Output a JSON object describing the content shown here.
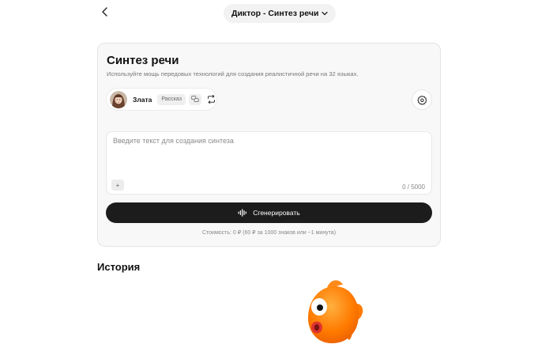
{
  "header": {
    "model_selector_label": "Диктор - Синтез речи"
  },
  "card": {
    "title": "Синтез речи",
    "subtitle": "Используйте мощь передовых технологий для создания реалистичной речи на 32 языках.",
    "voice": {
      "name": "Злата",
      "tag": "Рассказ"
    },
    "textarea": {
      "value": "",
      "placeholder": "Введите текст для создания синтеза"
    },
    "attach_label": "+",
    "char_count": "0 / 5000",
    "generate_label": "Сгенерировать",
    "cost_note": "Стоимость: 0 ₽ (60 ₽ за 1000 знаков или ~1 минута)"
  },
  "history": {
    "title": "История"
  },
  "colors": {
    "primary_button": "#1c1c1c",
    "card_background": "#f8f8f8",
    "fish_orange": "#ff7a00"
  },
  "icons": {
    "back": "chevron-left-icon",
    "dropdown": "chevron-down-icon",
    "voice_mode": "chat-bubbles-icon",
    "swap_voice": "swap-icon",
    "settings": "gear-icon",
    "generate": "soundwave-icon",
    "loading": "fish-mascot"
  }
}
